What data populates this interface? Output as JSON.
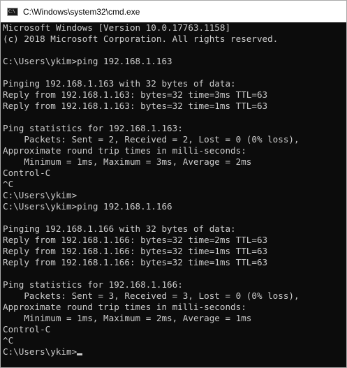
{
  "window": {
    "title": "C:\\Windows\\system32\\cmd.exe",
    "icon_name": "cmd-prompt-icon",
    "icon_text": "C:\\"
  },
  "colors": {
    "console_background": "#0c0c0c",
    "console_text": "#cccccc",
    "titlebar_background": "#ffffff"
  },
  "console": {
    "lines": [
      "Microsoft Windows [Version 10.0.17763.1158]",
      "(c) 2018 Microsoft Corporation. All rights reserved.",
      "",
      "C:\\Users\\ykim>ping 192.168.1.163",
      "",
      "Pinging 192.168.1.163 with 32 bytes of data:",
      "Reply from 192.168.1.163: bytes=32 time=3ms TTL=63",
      "Reply from 192.168.1.163: bytes=32 time=1ms TTL=63",
      "",
      "Ping statistics for 192.168.1.163:",
      "    Packets: Sent = 2, Received = 2, Lost = 0 (0% loss),",
      "Approximate round trip times in milli-seconds:",
      "    Minimum = 1ms, Maximum = 3ms, Average = 2ms",
      "Control-C",
      "^C",
      "C:\\Users\\ykim>",
      "C:\\Users\\ykim>ping 192.168.1.166",
      "",
      "Pinging 192.168.1.166 with 32 bytes of data:",
      "Reply from 192.168.1.166: bytes=32 time=2ms TTL=63",
      "Reply from 192.168.1.166: bytes=32 time=1ms TTL=63",
      "Reply from 192.168.1.166: bytes=32 time=1ms TTL=63",
      "",
      "Ping statistics for 192.168.1.166:",
      "    Packets: Sent = 3, Received = 3, Lost = 0 (0% loss),",
      "Approximate round trip times in milli-seconds:",
      "    Minimum = 1ms, Maximum = 2ms, Average = 1ms",
      "Control-C",
      "^C",
      "C:\\Users\\ykim>"
    ]
  }
}
